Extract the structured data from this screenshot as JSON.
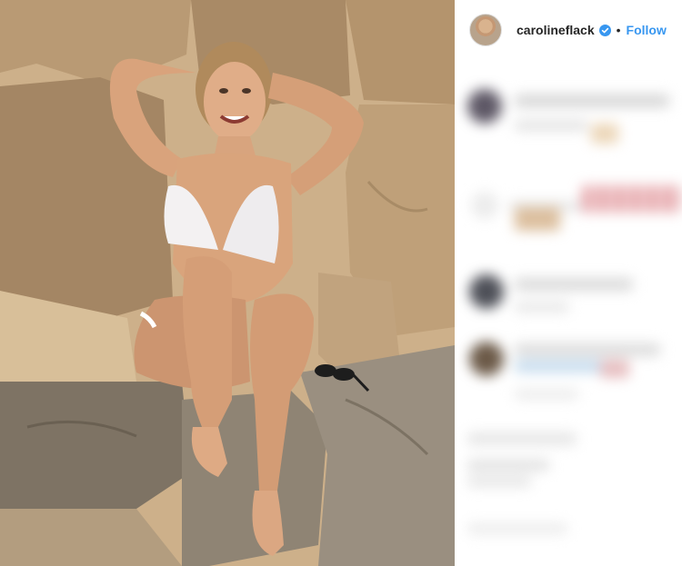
{
  "post": {
    "username": "carolineflack",
    "separator": "•",
    "follow_label": "Follow",
    "verified": true,
    "colors": {
      "follow": "#3897f0",
      "verified": "#3897f0",
      "username": "#262626"
    }
  },
  "icons": {
    "verified_badge": "verified-check-icon"
  },
  "comments": {
    "blurred": true,
    "count_visible": 4
  }
}
